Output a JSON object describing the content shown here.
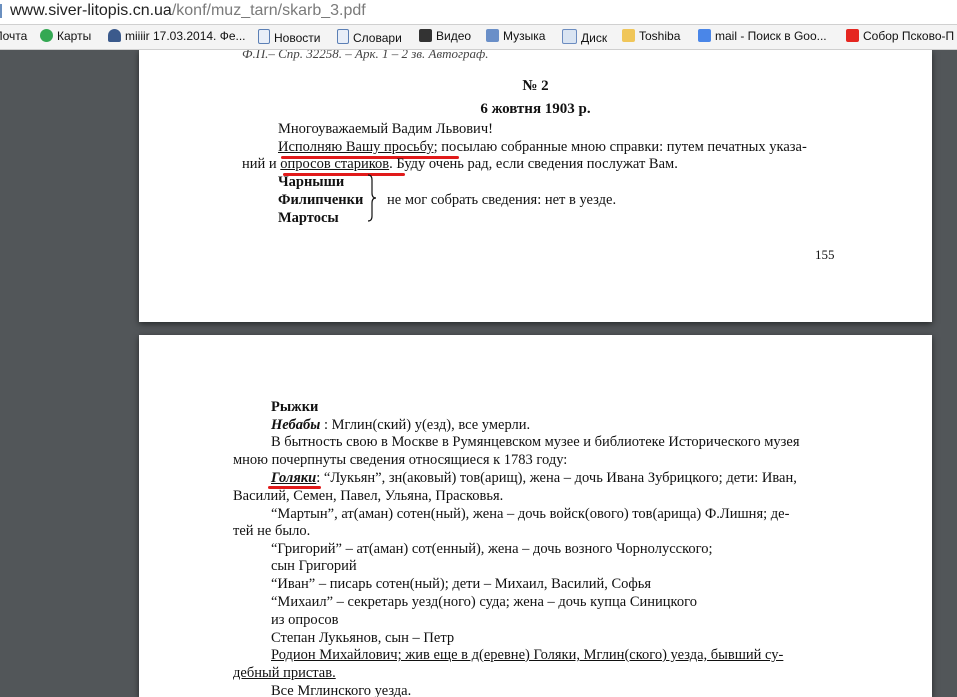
{
  "browser": {
    "url_main": "www.siver-litopis.cn.ua",
    "url_path": "/konf/muz_tarn/skarb_3.pdf"
  },
  "bookmarks": [
    {
      "label": "Почта",
      "icon": "mail-icon"
    },
    {
      "label": "Карты",
      "icon": "maps-icon"
    },
    {
      "label": "miiiir 17.03.2014. Фе...",
      "icon": "person-icon"
    },
    {
      "label": "Новости",
      "icon": "page-icon"
    },
    {
      "label": "Словари",
      "icon": "page-icon"
    },
    {
      "label": "Видео",
      "icon": "play-icon"
    },
    {
      "label": "Музыка",
      "icon": "audio-icon"
    },
    {
      "label": "Диск",
      "icon": "mail-icon"
    },
    {
      "label": "Toshiba",
      "icon": "folder-icon"
    },
    {
      "label": "mail - Поиск в Goo...",
      "icon": "google-icon"
    },
    {
      "label": "Собор Псково-П",
      "icon": "yandex-icon"
    }
  ],
  "page1": {
    "top_cut": "Ф.П.– Спр. 32258. – Арк. 1 – 2 зв. Автограф.",
    "number": "№ 2",
    "date": "6 жовтня 1903 р.",
    "greeting": "Многоуважаемый Вадим Львович!",
    "p1_underlined": "Исполняю Вашу просьбу",
    "p1_rest": "; посылаю собранные мною справки: путем печатных указа-",
    "p2_start": "ний и ",
    "p2_underlined": "опросов стариков",
    "p2_rest": ". Буду очень рад, если сведения послужат Вам.",
    "villages": [
      "Чарныши",
      "Филипченки",
      "Мартосы"
    ],
    "villages_note": "не мог собрать сведения: нет в уезде.",
    "page_number": "155"
  },
  "page2": {
    "heading": "Рыжки",
    "nebaby_label": "Небабы",
    "nebaby_text": " : Мглин(ский) у(езд), все умерли.",
    "l3": "В бытность свою в Москве в Румянцевском музее и библиотеке Исторического музея",
    "l4": "мною почерпнуты сведения относящиеся к 1783 году:",
    "golyaki_label": "Голяки",
    "l5_rest": ": “Лукьян”, зн(аковый) тов(арищ), жена – дочь Ивана Зубрицкого; дети: Иван,",
    "l6": "Василий, Семен, Павел, Ульяна, Прасковья.",
    "l7": "“Мартын”, ат(аман) сотен(ный), жена – дочь войск(ового) тов(арища) Ф.Лишня; де-",
    "l8": "тей не было.",
    "l9": "“Григорий” – ат(аман) сот(енный), жена – дочь возного Чорнолусского;",
    "l10": "сын Григорий",
    "l11": "“Иван” – писарь сотен(ный); дети – Михаил, Василий, Софья",
    "l12": "“Михаил” – секретарь уезд(ного) суда; жена – дочь купца Синицкого",
    "l13": "из опросов",
    "l14": "Степан Лукьянов, сын – Петр",
    "l15": "Родион Михайлович; жив еще в д(еревне) Голяки, Мглин(ского) уезда, бывший су-",
    "l16": "дебный пристав.",
    "l17": "Все Мглинского уезда."
  },
  "colors": {
    "viewer_bg": "#525659",
    "annotation_red": "#e11a1a"
  }
}
